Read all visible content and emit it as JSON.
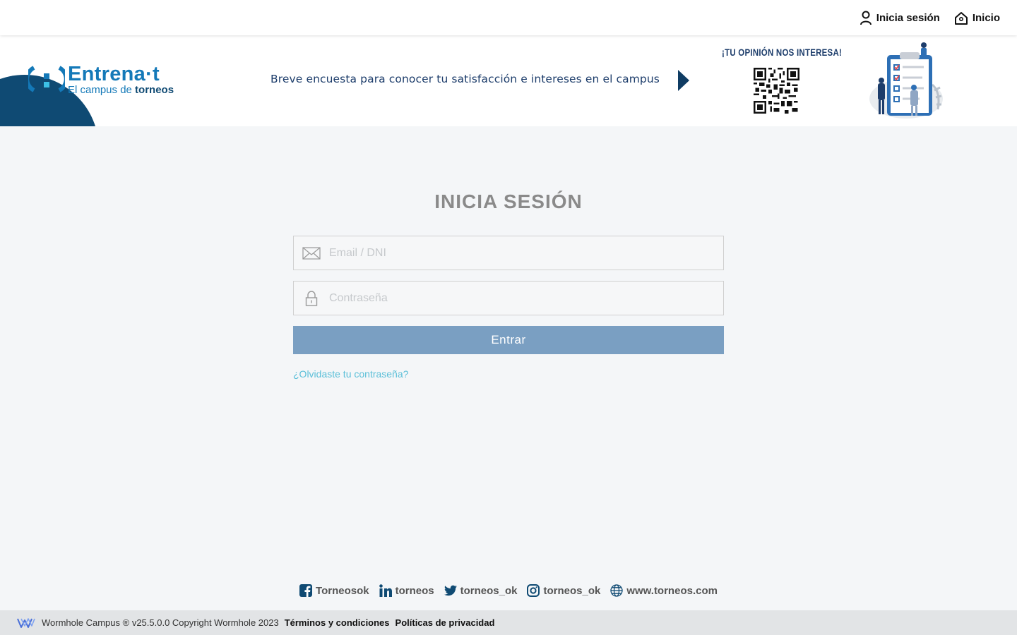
{
  "topnav": {
    "login_label": "Inicia sesión",
    "home_label": "Inicio",
    "login_icon": "user-icon",
    "home_icon": "home-icon"
  },
  "banner": {
    "logo_title_main": "Entrena",
    "logo_title_suffix": "·t",
    "logo_sub_prefix": "El campus de ",
    "logo_sub_brand": "torneos",
    "survey_text": "Breve encuesta para conocer tu satisfacción e intereses en el campus",
    "opinion_text": "¡TU OPINIÓN NOS INTERESA!"
  },
  "login": {
    "title": "INICIA SESIÓN",
    "email_placeholder": "Email / DNI",
    "password_placeholder": "Contraseña",
    "submit_label": "Entrar",
    "forgot_label": "¿Olvidaste tu contraseña?"
  },
  "social": [
    {
      "icon": "facebook-icon",
      "label": "Torneosok"
    },
    {
      "icon": "linkedin-icon",
      "label": "torneos"
    },
    {
      "icon": "twitter-icon",
      "label": "torneos_ok"
    },
    {
      "icon": "instagram-icon",
      "label": "torneos_ok"
    },
    {
      "icon": "globe-icon",
      "label": "www.torneos.com"
    }
  ],
  "footer": {
    "copyright": "Wormhole Campus ® v25.5.0.0 Copyright Wormhole 2023",
    "terms_label": "Términos y condiciones",
    "privacy_label": "Políticas de privacidad"
  },
  "colors": {
    "brand_dark": "#0f4a73",
    "brand_blue": "#1479b8",
    "button": "#7a9fc2",
    "link": "#5bbfd8",
    "social_icon": "#0f4a73"
  }
}
